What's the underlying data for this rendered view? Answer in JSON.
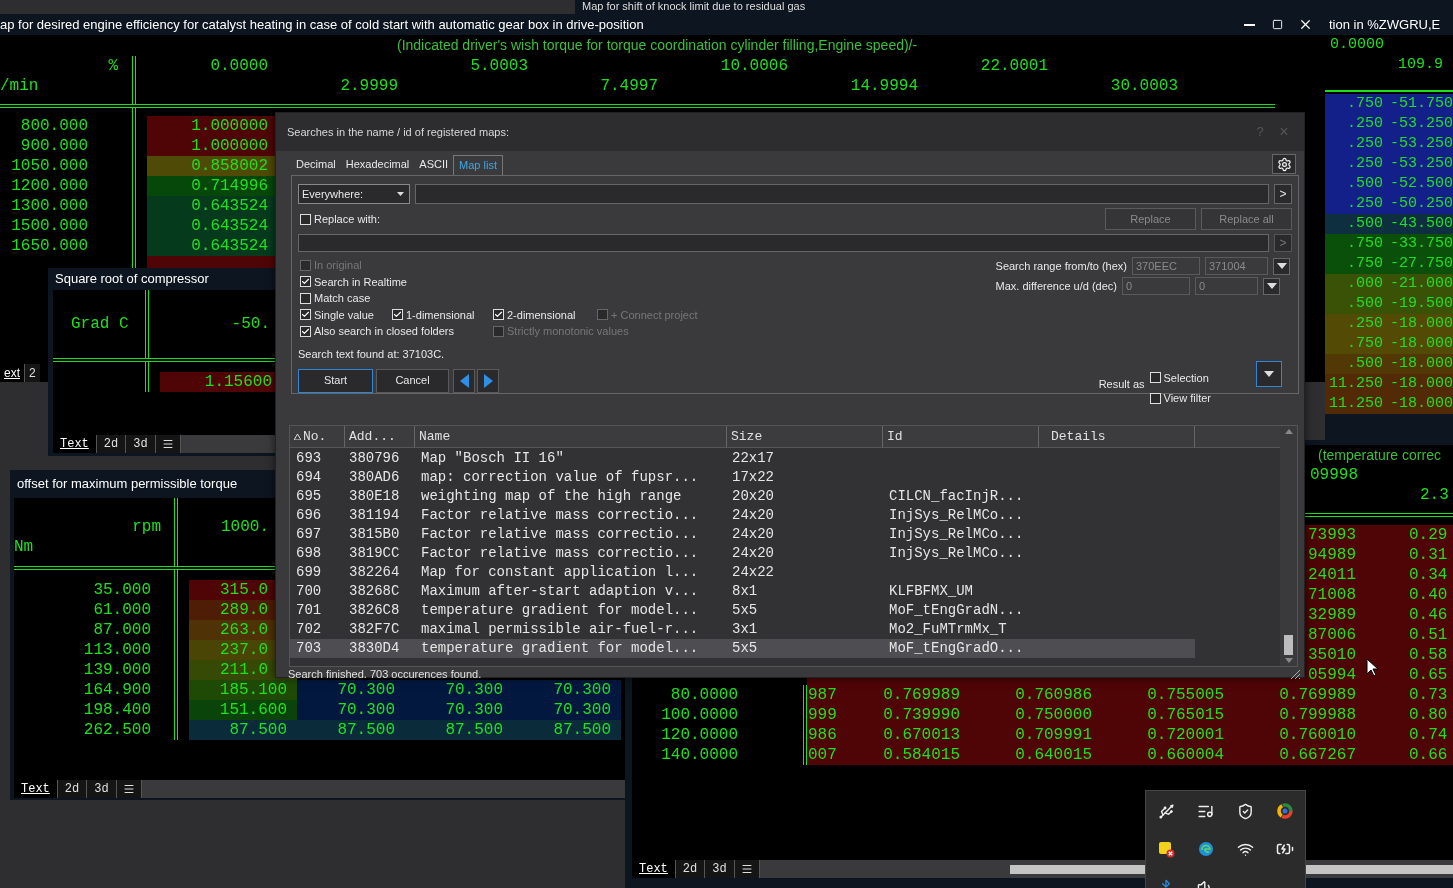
{
  "top_window": {
    "title": "Map for shift of knock limit due to residual gas"
  },
  "main_window": {
    "title": "ap for desired engine efficiency for catalyst heating in case of cold start with automatic gear box in drive-position",
    "axis_title": "(Indicated driver's wish torque for torque coordination cylinder filling,Engine speed)/-",
    "y_unit": "%",
    "x_unit": "/min",
    "x_axis": [
      "0.0000",
      "2.9999",
      "5.0003",
      "7.4997",
      "10.0006",
      "14.9994",
      "22.0001",
      "30.0003"
    ],
    "rows": [
      {
        "label": "800.000",
        "value": "1.000000",
        "color": "#4f0505"
      },
      {
        "label": "900.000",
        "value": "1.000000",
        "color": "#4f0505"
      },
      {
        "label": "1050.000",
        "value": "0.858002",
        "color": "#4f4a05"
      },
      {
        "label": "1200.000",
        "value": "0.714996",
        "color": "#05480a"
      },
      {
        "label": "1300.000",
        "value": "0.643524",
        "color": "#053a1c"
      },
      {
        "label": "1500.000",
        "value": "0.643524",
        "color": "#053a1c"
      },
      {
        "label": "1650.000",
        "value": "0.643524",
        "color": "#053a1c"
      },
      {
        "color": "#4f0505"
      }
    ],
    "tabs": [
      {
        "label": "ext",
        "selected": true
      },
      {
        "label": "2",
        "selected": false
      }
    ]
  },
  "right_window": {
    "title": "tion in %ZWGRU,E",
    "axis_values": [
      "0.0000",
      "109.9"
    ],
    "rows": [
      {
        "cells": [
          ".750",
          "-51.750"
        ],
        "color": "#14208a"
      },
      {
        "cells": [
          ".250",
          "-53.250"
        ],
        "color": "#14208a"
      },
      {
        "cells": [
          ".250",
          "-53.250"
        ],
        "color": "#14208a"
      },
      {
        "cells": [
          ".250",
          "-53.250"
        ],
        "color": "#14208a"
      },
      {
        "cells": [
          ".500",
          "-52.500"
        ],
        "color": "#14208a"
      },
      {
        "cells": [
          ".250",
          "-50.250"
        ],
        "color": "#14208a"
      },
      {
        "cells": [
          ".500",
          "-43.500"
        ],
        "color": "#0d2f3f"
      },
      {
        "cells": [
          ".750",
          "-33.750"
        ],
        "color": "#0a500a"
      },
      {
        "cells": [
          ".750",
          "-27.750"
        ],
        "color": "#0a500a"
      },
      {
        "cells": [
          ".000",
          "-21.000"
        ],
        "color": "#3a5205"
      },
      {
        "cells": [
          ".500",
          "-19.500"
        ],
        "color": "#3a5205"
      },
      {
        "cells": [
          ".250",
          "-18.000"
        ],
        "color": "#524a05"
      },
      {
        "cells": [
          ".750",
          "-18.000"
        ],
        "color": "#524a05"
      },
      {
        "cells": [
          ".500",
          "-18.000"
        ],
        "color": "#523805"
      },
      {
        "cells": [
          "11.250",
          "-18.000"
        ],
        "color": "#522a05"
      },
      {
        "cells": [
          "11.250",
          "-18.000"
        ],
        "color": "#522a05"
      }
    ]
  },
  "sqrt_window": {
    "title": "Square root of compressor",
    "row_unit": "Grad C",
    "axis_value": "-50.",
    "value": "1.15600",
    "tabs": [
      {
        "label": "Text",
        "selected": true
      },
      {
        "label": "2d",
        "selected": false
      },
      {
        "label": "3d",
        "selected": false
      }
    ]
  },
  "offset_window": {
    "title": "offset for maximum permissible torque",
    "x_unit": "rpm",
    "y_unit": "Nm",
    "x_axis_value": "1000.",
    "rows": [
      {
        "label": "35.000",
        "kind": "cut",
        "cells": [
          {
            "text": "315.0",
            "color": "#4f0505"
          }
        ]
      },
      {
        "label": "61.000",
        "kind": "cut",
        "cells": [
          {
            "text": "289.0",
            "color": "#4f1c05"
          }
        ]
      },
      {
        "label": "87.000",
        "kind": "cut",
        "cells": [
          {
            "text": "263.0",
            "color": "#4f3205"
          }
        ]
      },
      {
        "label": "113.000",
        "kind": "cut",
        "cells": [
          {
            "text": "237.0",
            "color": "#4a4505"
          }
        ]
      },
      {
        "label": "139.000",
        "kind": "cut",
        "cells": [
          {
            "text": "211.0",
            "color": "#364a05"
          }
        ]
      },
      {
        "label": "164.900",
        "kind": "full",
        "cells": [
          {
            "text": "185.100",
            "color": "#1f4a05"
          },
          {
            "text": "70.300",
            "color": "#03183f"
          },
          {
            "text": "70.300",
            "color": "#03183f"
          },
          {
            "text": "70.300",
            "color": "#03183f"
          }
        ]
      },
      {
        "label": "198.400",
        "kind": "full",
        "cells": [
          {
            "text": "151.600",
            "color": "#0a440a"
          },
          {
            "text": "70.300",
            "color": "#03183f"
          },
          {
            "text": "70.300",
            "color": "#03183f"
          },
          {
            "text": "70.300",
            "color": "#03183f"
          }
        ]
      },
      {
        "label": "262.500",
        "kind": "full",
        "cells": [
          {
            "text": "87.500",
            "color": "#0a2c3a"
          },
          {
            "text": "87.500",
            "color": "#0a2c3a"
          },
          {
            "text": "87.500",
            "color": "#0a2c3a"
          },
          {
            "text": "87.500",
            "color": "#0a2c3a"
          }
        ]
      }
    ],
    "tabs": [
      {
        "label": "Text",
        "selected": true
      },
      {
        "label": "2d",
        "selected": false
      },
      {
        "label": "3d",
        "selected": false
      }
    ]
  },
  "bottom_window": {
    "axis_title": "(temperature correc",
    "axis_values": [
      "09998",
      "2.3"
    ],
    "rows": [
      {
        "kind": "partial",
        "cells": [
          "73993",
          "0.29"
        ]
      },
      {
        "kind": "partial",
        "cells": [
          "94989",
          "0.31"
        ]
      },
      {
        "kind": "partial",
        "cells": [
          "24011",
          "0.34"
        ]
      },
      {
        "kind": "partial",
        "cells": [
          "71008",
          "0.40"
        ]
      },
      {
        "kind": "partial",
        "cells": [
          "32989",
          "0.46"
        ]
      },
      {
        "kind": "partial",
        "cells": [
          "87006",
          "0.51"
        ]
      },
      {
        "kind": "partial",
        "cells": [
          "35010",
          "0.58"
        ]
      },
      {
        "kind": "partial",
        "cells": [
          "05994",
          "0.65"
        ]
      },
      {
        "kind": "full",
        "label": "80.0000",
        "cells": [
          "987",
          "0.769989",
          "0.760986",
          "0.755005",
          "0.769989",
          "0.73"
        ]
      },
      {
        "kind": "full",
        "label": "100.0000",
        "cells": [
          "999",
          "0.739990",
          "0.750000",
          "0.765015",
          "0.799988",
          "0.80"
        ]
      },
      {
        "kind": "full",
        "label": "120.0000",
        "cells": [
          "986",
          "0.670013",
          "0.709991",
          "0.720001",
          "0.760010",
          "0.74"
        ]
      },
      {
        "kind": "full",
        "label": "140.0000",
        "cells": [
          "007",
          "0.584015",
          "0.640015",
          "0.660004",
          "0.667267",
          "0.66"
        ]
      }
    ],
    "tabs": [
      {
        "label": "Text",
        "selected": true
      },
      {
        "label": "2d",
        "selected": false
      },
      {
        "label": "3d",
        "selected": false
      }
    ]
  },
  "search_dialog": {
    "title": "Searches in the name / id of registered maps:",
    "help": "?",
    "close": "×",
    "tabs": [
      {
        "label": "Decimal",
        "selected": false
      },
      {
        "label": "Hexadecimal",
        "selected": false
      },
      {
        "label": "ASCII",
        "selected": false
      },
      {
        "label": "Map list",
        "selected": true
      }
    ],
    "scope": "Everywhere:",
    "go": ">",
    "replace": {
      "label": "Replace with:",
      "checked": false
    },
    "replace_buttons": [
      "Replace",
      "Replace all"
    ],
    "replace_go": ">",
    "option_rows": [
      {
        "options": [
          {
            "label": "In original",
            "checked": false,
            "disabled": true
          }
        ]
      },
      {
        "options": [
          {
            "label": "Search in Realtime",
            "checked": true,
            "disabled": false
          }
        ]
      },
      {
        "options": [
          {
            "label": "Match case",
            "checked": false,
            "disabled": false
          }
        ]
      },
      {
        "options": [
          {
            "label": "Single value",
            "checked": true,
            "disabled": false
          },
          {
            "label": "1-dimensional",
            "checked": true,
            "disabled": false
          },
          {
            "label": "2-dimensional",
            "checked": true,
            "disabled": false
          },
          {
            "label": "+ Connect project",
            "checked": false,
            "disabled": true
          }
        ]
      },
      {
        "options": [
          {
            "label": "Also search in closed folders",
            "checked": true,
            "disabled": false
          },
          {
            "label": "Strictly monotonic values",
            "checked": false,
            "disabled": true
          }
        ]
      }
    ],
    "ranges": [
      {
        "label": "Search range from/to (hex)",
        "from": "370EEC",
        "to": "371004"
      },
      {
        "label": "Max. difference u/d (dec)",
        "from": "0",
        "to": "0"
      }
    ],
    "found_text": "Search text found at: 37103C.",
    "start": "Start",
    "cancel": "Cancel",
    "result_as": "Result as",
    "result_options": [
      {
        "label": "Selection",
        "checked": false
      },
      {
        "label": "View filter",
        "checked": false
      }
    ],
    "table": {
      "columns": [
        "No.",
        "Add...",
        "Name",
        "Size",
        "Id",
        "Details"
      ],
      "rows": [
        {
          "no": "693",
          "address": "380796",
          "name": "Map \"Bosch II 16\"",
          "size": "22x17",
          "selected": false
        },
        {
          "no": "694",
          "address": "380AD6",
          "name": "map: correction value of fupsr...",
          "size": "17x22",
          "selected": false
        },
        {
          "no": "695",
          "address": "380E18",
          "name": "weighting map of the high range",
          "size": "20x20",
          "id": "CILCN_facInjR...",
          "selected": false
        },
        {
          "no": "696",
          "address": "381194",
          "name": "Factor relative mass correctio...",
          "size": "24x20",
          "id": "InjSys_RelMCo...",
          "selected": false
        },
        {
          "no": "697",
          "address": "3815B0",
          "name": "Factor relative mass correctio...",
          "size": "24x20",
          "id": "InjSys_RelMCo...",
          "selected": false
        },
        {
          "no": "698",
          "address": "3819CC",
          "name": "Factor relative mass correctio...",
          "size": "24x20",
          "id": "InjSys_RelMCo...",
          "selected": false
        },
        {
          "no": "699",
          "address": "382264",
          "name": "Map for constant application l...",
          "size": "24x22",
          "selected": false
        },
        {
          "no": "700",
          "address": "38268C",
          "name": "Maximum after-start adaption v...",
          "size": "8x1",
          "id": "KLFBFMX_UM",
          "selected": false
        },
        {
          "no": "701",
          "address": "3826C8",
          "name": "temperature gradient for model...",
          "size": "5x5",
          "id": "MoF_tEngGradN...",
          "selected": false
        },
        {
          "no": "702",
          "address": "382F7C",
          "name": "maximal permissible air-fuel-r...",
          "size": "3x1",
          "id": "Mo2_FuMTrmMx_T",
          "selected": false
        },
        {
          "no": "703",
          "address": "3830D4",
          "name": "temperature gradient for model...",
          "size": "5x5",
          "id": "MoF_tEngGradO...",
          "selected": true
        }
      ]
    },
    "status": "Search finished. 703 occurences found."
  }
}
